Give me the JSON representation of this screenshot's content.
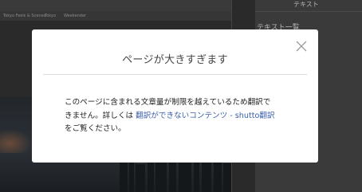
{
  "background": {
    "topbar_items": [
      "",
      "",
      "",
      ""
    ],
    "subnav_items": [
      "Tokyo Feels & Scenes",
      "Tokyo",
      "Weekender"
    ],
    "right_panel_title": "テキスト",
    "right_panel_subtitle": "テキスト一覧"
  },
  "modal": {
    "title": "ページが大きすぎます",
    "close_icon": "close-icon",
    "body": {
      "line1": "このページに含まれる文章量が制限を越えているため翻訳で",
      "line2_prefix": "きません。詳しくは ",
      "link_text": "翻訳ができないコンテンツ - shutto翻訳",
      "line3": "をご覧ください。"
    }
  },
  "colors": {
    "overlay": "#2a2a2a",
    "link": "#3a5fa8",
    "title": "#444444",
    "body_text": "#222222"
  }
}
